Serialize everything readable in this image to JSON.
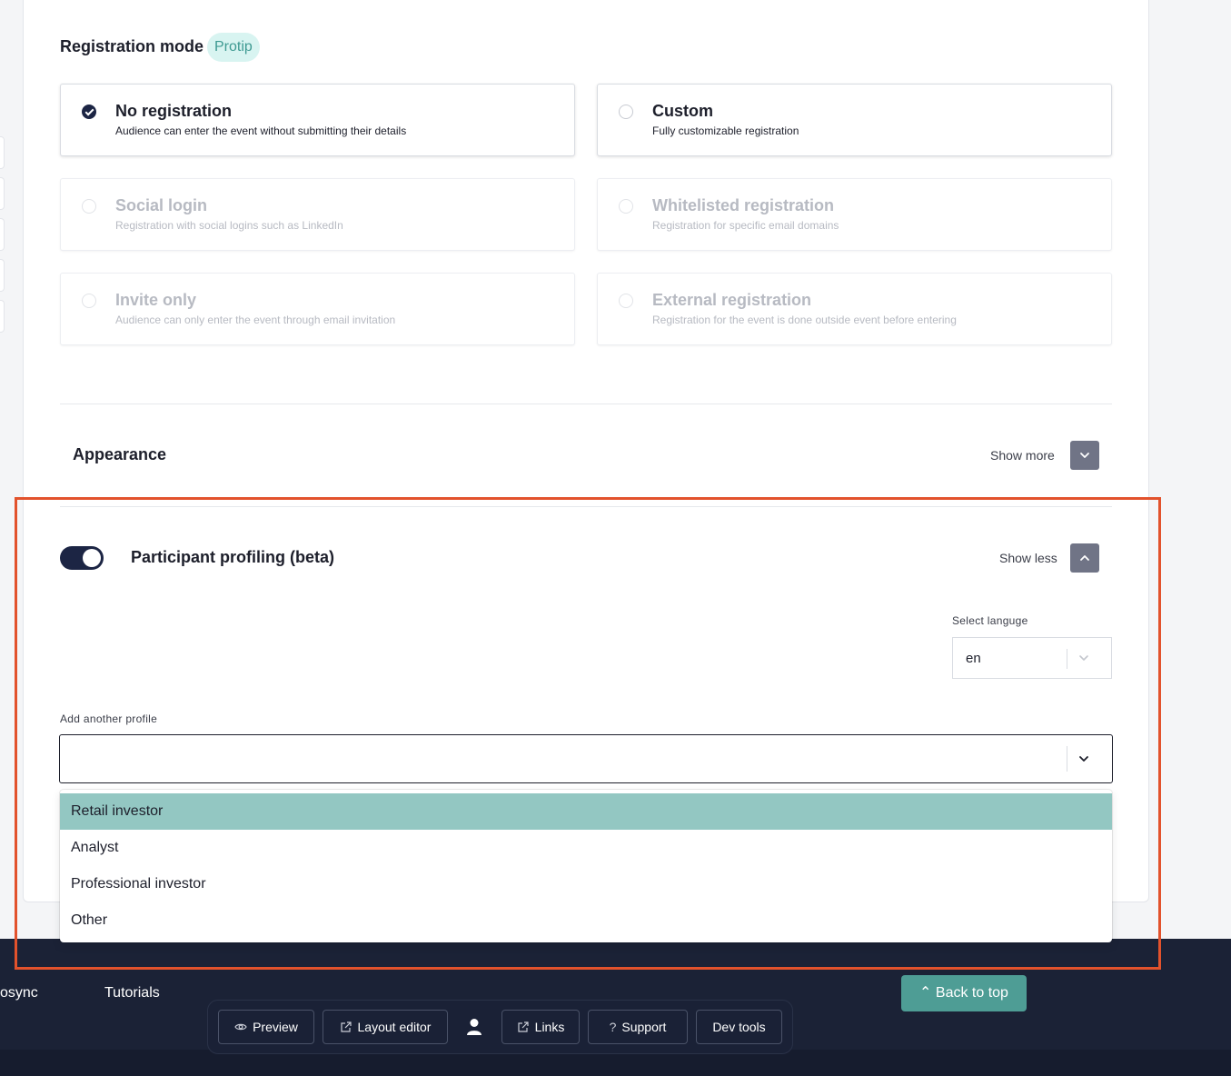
{
  "registration": {
    "title": "Registration mode",
    "badge": "Protip",
    "options": [
      {
        "title": "No registration",
        "desc": "Audience can enter the event without submitting their details"
      },
      {
        "title": "Custom",
        "desc": "Fully customizable registration"
      },
      {
        "title": "Social login",
        "desc": "Registration with social logins such as LinkedIn"
      },
      {
        "title": "Whitelisted registration",
        "desc": "Registration for specific email domains"
      },
      {
        "title": "Invite only",
        "desc": "Audience can only enter the event through email invitation"
      },
      {
        "title": "External registration",
        "desc": "Registration for the event is done outside event before entering"
      }
    ]
  },
  "appearance": {
    "title": "Appearance",
    "toggle_label": "Show more"
  },
  "profiling": {
    "title": "Participant profiling (beta)",
    "toggle_label": "Show less",
    "enabled": true,
    "language_label": "Select languge",
    "language_value": "en",
    "profile_label": "Add another profile",
    "profile_value": "",
    "profile_options": [
      "Retail investor",
      "Analyst",
      "Professional investor",
      "Other"
    ],
    "highlighted_option": "Retail investor"
  },
  "footer": {
    "link_partial": "osync",
    "link_tutorials": "Tutorials",
    "back_to_top": "Back to top"
  },
  "toolbar": {
    "preview": "Preview",
    "layout_editor": "Layout editor",
    "links": "Links",
    "support": "Support",
    "dev_tools": "Dev tools"
  },
  "colors": {
    "accent": "#1c2544",
    "teal": "#4e9d95",
    "highlight_row": "#93c7c2",
    "annotation": "#e2522c"
  }
}
